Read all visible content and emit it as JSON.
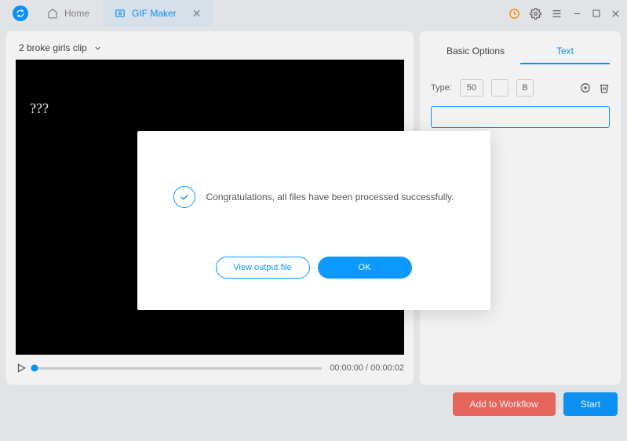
{
  "titlebar": {
    "tabs": [
      {
        "label": "Home",
        "active": false
      },
      {
        "label": "GIF Maker",
        "active": true
      }
    ]
  },
  "left": {
    "clip_name": "2 broke girls clip",
    "overlay_text": "???",
    "timecode": "00:00:00 / 00:00:02"
  },
  "right": {
    "tab_basic": "Basic Options",
    "tab_text": "Text",
    "type_label": "Type:",
    "font_size": "50",
    "bold_label": "B",
    "text_value": ""
  },
  "footer": {
    "workflow": "Add to Workflow",
    "start": "Start"
  },
  "modal": {
    "message": "Congratulations, all files have been processed successfully.",
    "view_btn": "View output file",
    "ok_btn": "OK"
  }
}
